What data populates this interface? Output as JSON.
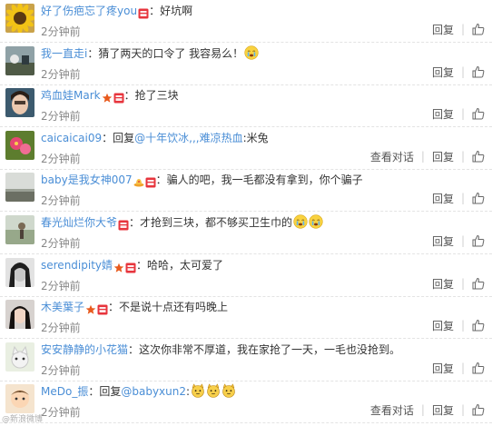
{
  "colors": {
    "username": "#4a8ed6",
    "text": "#333333",
    "time": "#888888",
    "vip": "#e7353d",
    "rank": "#e85a1d"
  },
  "actions": {
    "reply": "回复",
    "view_conversation": "查看对话",
    "separator": "|"
  },
  "comments": [
    {
      "username": "好了伤疤忘了疼you",
      "colon": "：",
      "text": "好坑啊",
      "time": "2分钟前",
      "badges": [
        "vip-icon"
      ],
      "avatar": "sunflower-avatar"
    },
    {
      "username": "我一直走i",
      "colon": "：",
      "text": "猜了两天的口令了 我容易么！",
      "time": "2分钟前",
      "badges": [],
      "emoji": [
        "crying-emoji"
      ],
      "avatar": "landscape-avatar"
    },
    {
      "username": "鸡血娃Mark",
      "colon": "：",
      "text": "抢了三块",
      "time": "2分钟前",
      "badges": [
        "star-icon",
        "vip-icon"
      ],
      "avatar": "girl-avatar"
    },
    {
      "username": "caicaicai09",
      "colon": "：",
      "text_pre": "回复",
      "mention": "@十年饮冰,,,难凉热血",
      "text": ":米兔",
      "time": "2分钟前",
      "badges": [],
      "view_conversation": true,
      "avatar": "flower-avatar"
    },
    {
      "username": "baby是我女神007",
      "colon": "：",
      "text": "骗人的吧，我一毛都没有拿到，你个骗子",
      "time": "2分钟前",
      "badges": [
        "hat-icon",
        "vip-icon"
      ],
      "avatar": "sky-avatar"
    },
    {
      "username": "春光灿烂你大爷",
      "colon": "：",
      "text": "才抢到三块，都不够买卫生巾的",
      "time": "2分钟前",
      "badges": [
        "vip-icon"
      ],
      "emoji": [
        "crying-emoji",
        "crying-emoji"
      ],
      "avatar": "field-avatar"
    },
    {
      "username": "serendipity婧",
      "colon": "：",
      "text": "哈哈，太可爱了",
      "time": "2分钟前",
      "badges": [
        "star-icon",
        "vip-icon"
      ],
      "avatar": "bw-avatar"
    },
    {
      "username": "木美葉子",
      "colon": "：",
      "text": "不是说十点还有吗晚上",
      "time": "2分钟前",
      "badges": [
        "star-icon",
        "vip-icon"
      ],
      "avatar": "dark-hair-avatar"
    },
    {
      "username": "安安静静的小花猫",
      "colon": "：",
      "text": "这次你非常不厚道，我在家抢了一天，一毛也没抢到。",
      "time": "2分钟前",
      "badges": [],
      "avatar": "cat-avatar"
    },
    {
      "username": "MeDo_振",
      "colon": "：",
      "text_pre": "回复",
      "mention": "@babyxun2",
      "text": ":",
      "time": "2分钟前",
      "badges": [],
      "emoji": [
        "cat-emoji",
        "cat-emoji",
        "cat-emoji"
      ],
      "view_conversation": true,
      "avatar": "cartoon-avatar"
    }
  ],
  "watermark": "@新浪微博"
}
